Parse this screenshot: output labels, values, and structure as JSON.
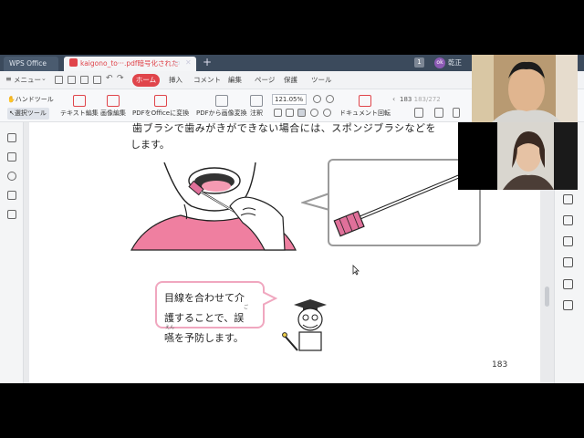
{
  "tabs": {
    "app_tab": "WPS Office",
    "doc_tab": "kaigono_to···.pdf暗号化された",
    "tab_badge": "1",
    "avatar": "ok",
    "user_label": "乾正"
  },
  "menu": {
    "menu_label": "メニュー",
    "home": "ホーム",
    "items": [
      "挿入",
      "コメント",
      "編集",
      "ページ",
      "保護",
      "ツール"
    ]
  },
  "toolbar": {
    "hand_tool": "ハンドツール",
    "select_tool": "選択ツール",
    "text_edit": "テキスト編集",
    "image_edit": "画像編集",
    "pdf_to_office": "PDFをOfficeに変換",
    "pdf_to_image": "PDFから画像変換",
    "annotate": "注釈",
    "zoom": "121.05%",
    "doc_rotate": "ドキュメント回転",
    "page_indicator": "183",
    "page_total": "183/272"
  },
  "document": {
    "body_line_1": "歯ブラシで歯みがきができない場合には、スポンジブラシなどを",
    "body_line_2": "します。",
    "speech_line_1": "目線を合わせて介",
    "speech_line_2": "護することで、誤",
    "speech_line_3": "嚥を予防します。",
    "ruby_goe": "ご",
    "ruby_en": "えん",
    "page_number": "183"
  },
  "colors": {
    "accent": "#e0454b",
    "speech_border": "#f0a7bf",
    "shirt": "#ef7fa0",
    "sponge": "#e0709a"
  },
  "icons": {
    "doctor": "professor-illustration",
    "patient": "patient-mouth-illustration"
  }
}
